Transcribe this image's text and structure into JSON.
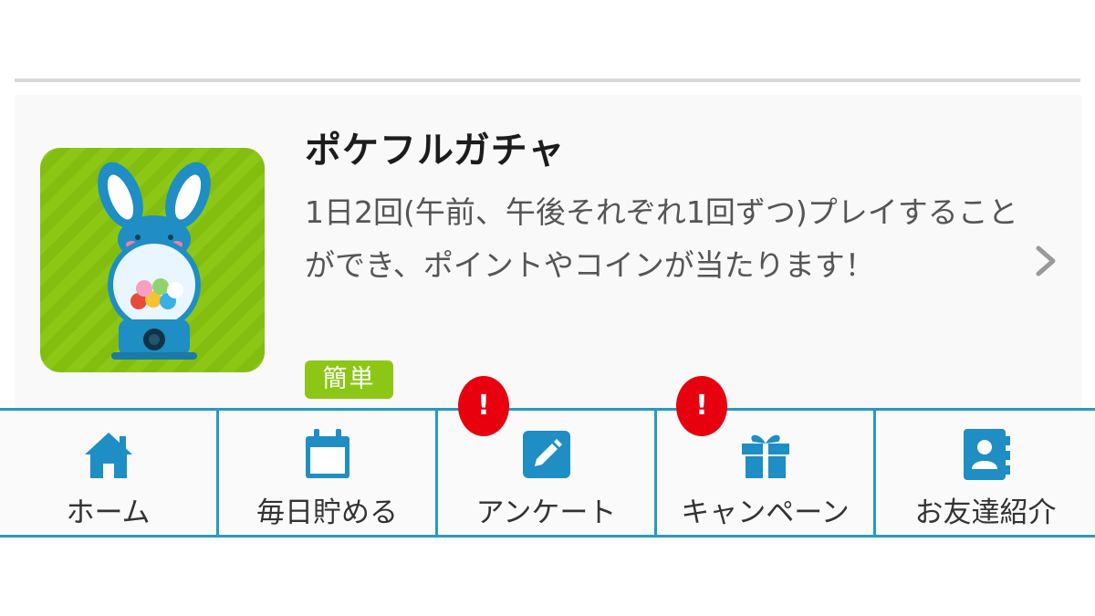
{
  "card": {
    "title": "ポケフルガチャ",
    "description": "1日2回(午前、午後それぞれ1回ずつ)プレイすることができ、ポイントやコインが当たります！",
    "tag": "簡単"
  },
  "tabs": [
    {
      "label": "ホーム",
      "icon": "home-icon"
    },
    {
      "label": "毎日貯める",
      "icon": "calendar-icon"
    },
    {
      "label": "アンケート",
      "icon": "edit-icon",
      "badge": "!"
    },
    {
      "label": "キャンペーン",
      "icon": "gift-icon",
      "badge": "!"
    },
    {
      "label": "お友達紹介",
      "icon": "contact-book-icon"
    }
  ],
  "colors": {
    "accent": "#2799c3",
    "tag_green": "#8cc716",
    "badge_red": "#e8000f"
  }
}
